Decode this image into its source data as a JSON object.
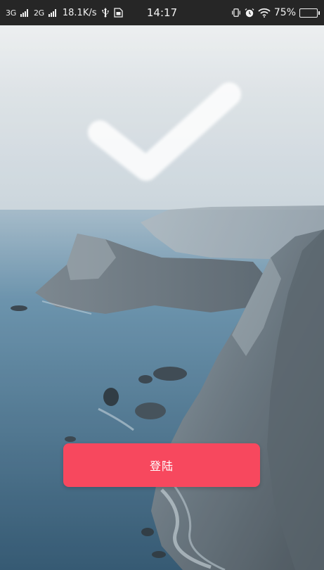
{
  "status_bar": {
    "network_1": "3G",
    "network_2": "2G",
    "speed": "18.1K/s",
    "time": "14:17",
    "battery_level": "75%",
    "battery_fraction": 0.75,
    "icons": [
      "signal-icon",
      "signal-icon",
      "usb-icon",
      "sim-icon",
      "vibrate-icon",
      "alarm-icon",
      "wifi-icon",
      "battery-charging-icon"
    ]
  },
  "main": {
    "check_icon": "check-icon",
    "login_label": "登陆",
    "colors": {
      "button": "#f7485e",
      "status_bar": "#262626",
      "sea": "#2d5a78",
      "sky": "#d9dfe4"
    }
  }
}
